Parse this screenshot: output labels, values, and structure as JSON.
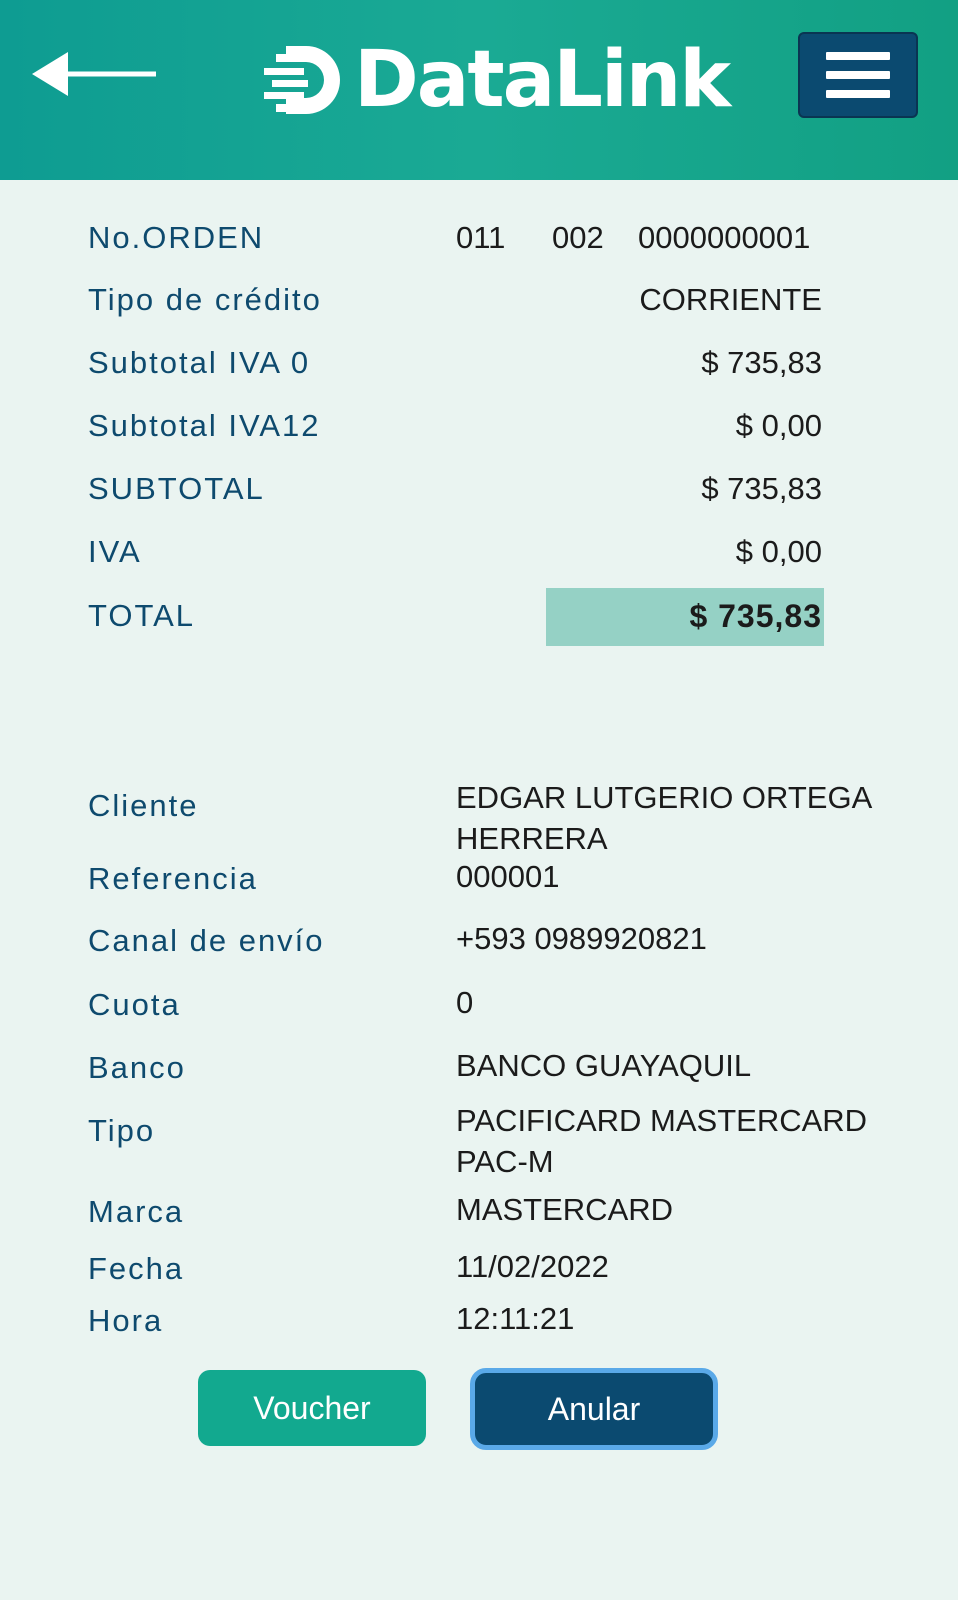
{
  "header": {
    "logo_text": "DataLink",
    "colors": {
      "header_bg": "#0e9c92",
      "menu_bg": "#0b4a70"
    }
  },
  "order": {
    "label": "No.ORDEN",
    "part1": "011",
    "part2": "002",
    "part3": "0000000001"
  },
  "summary": [
    {
      "label": "Tipo de crédito",
      "value": "CORRIENTE"
    },
    {
      "label": "Subtotal IVA 0",
      "value": "$ 735,83"
    },
    {
      "label": "Subtotal IVA12",
      "value": "$ 0,00"
    },
    {
      "label": "SUBTOTAL",
      "value": "$ 735,83"
    },
    {
      "label": "IVA",
      "value": "$ 0,00"
    }
  ],
  "total": {
    "label": "TOTAL",
    "value": "$ 735,83"
  },
  "details": {
    "cliente": {
      "label": "Cliente",
      "line1": "EDGAR LUTGERIO ORTEGA",
      "line2": "HERRERA"
    },
    "referencia": {
      "label": "Referencia",
      "value": "000001"
    },
    "canal": {
      "label": "Canal de envío",
      "value": "+593 0989920821"
    },
    "cuota": {
      "label": "Cuota",
      "value": "0"
    },
    "banco": {
      "label": "Banco",
      "value": "BANCO GUAYAQUIL"
    },
    "tipo": {
      "label": "Tipo",
      "line1": "PACIFICARD MASTERCARD",
      "line2": "PAC-M"
    },
    "marca": {
      "label": "Marca",
      "value": "MASTERCARD"
    },
    "fecha": {
      "label": "Fecha",
      "value": "11/02/2022"
    },
    "hora": {
      "label": "Hora",
      "value": "12:11:21"
    }
  },
  "buttons": {
    "voucher": "Voucher",
    "anular": "Anular"
  }
}
